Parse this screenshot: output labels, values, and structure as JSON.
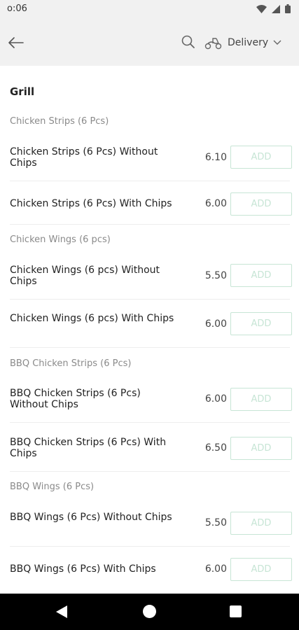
{
  "status_bar": {
    "time": "o:06",
    "icons": [
      "wifi-icon",
      "signal-icon",
      "battery-icon"
    ]
  },
  "app_bar": {
    "back_icon": "arrow-left-icon",
    "search_icon": "search-icon",
    "delivery_icon": "scooter-icon",
    "delivery_label": "Delivery",
    "dropdown_icon": "chevron-down-icon"
  },
  "menu": {
    "section_title": "Grill",
    "groups": [
      {
        "title": "Chicken Strips (6 Pcs)",
        "items": [
          {
            "name": "Chicken Strips (6 Pcs) Without Chips",
            "price": "6.10",
            "button": "ADD"
          },
          {
            "name": "Chicken Strips (6 Pcs) With Chips",
            "price": "6.00",
            "button": "ADD"
          }
        ]
      },
      {
        "title": "Chicken Wings (6 pcs)",
        "items": [
          {
            "name": "Chicken Wings (6 pcs) Without Chips",
            "price": "5.50",
            "button": "ADD"
          },
          {
            "name": "Chicken Wings (6 pcs) With Chips",
            "price": "6.00",
            "button": "ADD"
          }
        ]
      },
      {
        "title": "BBQ Chicken Strips (6 Pcs)",
        "items": [
          {
            "name": "BBQ Chicken Strips (6 Pcs) Without Chips",
            "price": "6.00",
            "button": "ADD"
          },
          {
            "name": "BBQ Chicken Strips (6 Pcs) With Chips",
            "price": "6.50",
            "button": "ADD"
          }
        ]
      },
      {
        "title": "BBQ Wings (6 Pcs)",
        "items": [
          {
            "name": "BBQ Wings (6 Pcs) Without Chips",
            "price": "5.50",
            "button": "ADD"
          },
          {
            "name": "BBQ Wings (6 Pcs) With Chips",
            "price": "6.00",
            "button": "ADD"
          }
        ]
      }
    ]
  },
  "colors": {
    "accent_outline": "#c7e5d5",
    "app_bar_bg": "#f1f1f1",
    "nav_bar_bg": "#000000"
  },
  "nav_bar": {
    "icons": [
      "nav-back-icon",
      "nav-home-icon",
      "nav-recents-icon"
    ]
  }
}
